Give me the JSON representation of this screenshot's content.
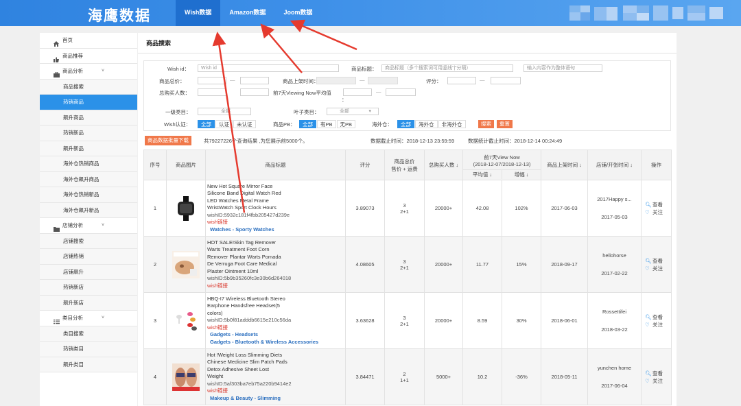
{
  "header": {
    "logo": "海鹰数据",
    "tabs": [
      {
        "label": "Wish数据",
        "active": true
      },
      {
        "label": "Amazon数据",
        "active": false
      },
      {
        "label": "Joom数据",
        "active": false
      }
    ]
  },
  "sidebar": {
    "items": [
      {
        "label": "首页",
        "level": "top",
        "icon": "home-icon"
      },
      {
        "label": "商品推荐",
        "level": "top",
        "icon": "thumbs-up-icon"
      },
      {
        "label": "商品分析",
        "level": "top",
        "icon": "briefcase-icon",
        "chevron": "˅"
      },
      {
        "label": "商品搜索",
        "level": "sub"
      },
      {
        "label": "热销商品",
        "level": "sub",
        "active": true
      },
      {
        "label": "飙升商品",
        "level": "sub"
      },
      {
        "label": "热销新品",
        "level": "sub"
      },
      {
        "label": "飙升新品",
        "level": "sub"
      },
      {
        "label": "海外仓热销商品",
        "level": "sub"
      },
      {
        "label": "海外仓飙升商品",
        "level": "sub"
      },
      {
        "label": "海外仓热销新品",
        "level": "sub"
      },
      {
        "label": "海外仓飙升新品",
        "level": "sub"
      },
      {
        "label": "店铺分析",
        "level": "top",
        "icon": "folder-icon",
        "chevron": "˅"
      },
      {
        "label": "店铺搜索",
        "level": "sub"
      },
      {
        "label": "店铺热销",
        "level": "sub"
      },
      {
        "label": "店铺飙升",
        "level": "sub"
      },
      {
        "label": "热销新店",
        "level": "sub"
      },
      {
        "label": "飙升新店",
        "level": "sub"
      },
      {
        "label": "类目分析",
        "level": "top",
        "icon": "list-icon",
        "chevron": "˅"
      },
      {
        "label": "类目搜索",
        "level": "sub"
      },
      {
        "label": "热销类目",
        "level": "sub"
      },
      {
        "label": "飙升类目",
        "level": "sub"
      }
    ]
  },
  "page": {
    "title": "商品搜索"
  },
  "filter": {
    "wish_id_label": "Wish id：",
    "wish_id_placeholder": "Wish id",
    "title_label": "商品标题：",
    "title_placeholder": "商品标题（多个搜索词可用竖线“|”分隔）",
    "exclude_placeholder": "输入内容作为整体语句",
    "total_price_label": "商品总价：",
    "listed_time_label": "商品上架时间：",
    "rating_label": "评分：",
    "buyers_label": "总购买人数：",
    "viewing_label": "前7天Viewing Now平均值",
    "viewing_colon": "：",
    "dash": "—",
    "cat1_label": "一级类目：",
    "cat1_value": "全部",
    "leaf_label": "叶子类目：",
    "leaf_value": "全部",
    "leaf_arrow": "▾",
    "wish_auth_label": "Wish认证：",
    "wish_auth_options": [
      "全部",
      "认证",
      "未认证"
    ],
    "pb_label": "商品PB：",
    "pb_options": [
      "全部",
      "有PB",
      "无PB"
    ],
    "overseas_label": "海外仓：",
    "overseas_options": [
      "全部",
      "海外仓",
      "非海外仓"
    ],
    "search_btn": "搜索",
    "reset_btn": "重置"
  },
  "results": {
    "export_btn": "商品数据批量下载",
    "count_text": "共79227226个查询结果 ,为您展示前5000个。",
    "data_cutoff": "数据截止时间：2018-12-13 23:59:59",
    "stats_cutoff": "数据统计截止时间：2018-12-14 00:24:49"
  },
  "table": {
    "headers": {
      "no": "序号",
      "image": "商品图片",
      "title": "商品标题",
      "rating": "评分",
      "price": "商品总价",
      "price2": "售价 + 运费",
      "buyers": "总购买人数 ↓",
      "viewing": "前7天View Now",
      "viewing_range": "(2018-12-07/2018-12-13)",
      "avg": "平均值 ↓",
      "growth": "增幅 ↓",
      "listed": "商品上架时间 ↓",
      "shop": "店铺/开张时间 ↓",
      "ops": "操作"
    },
    "rows": [
      {
        "no": "1",
        "lines": [
          "New Hot Square Mirror Face",
          "Silicone Band Digital Watch Red",
          "LED Watches Metal Frame",
          "WristWatch Sport Clock Hours"
        ],
        "wish_id": "wishID:5932c181f4fbb205427d239e",
        "wish_link": "wish链接",
        "cats": [
          "Watches - Sporty Watches"
        ],
        "rating": "3.89073",
        "price": "3",
        "price2": "2+1",
        "buyers": "20000+",
        "avg": "42.08",
        "growth": "102%",
        "listed": "2017-06-03",
        "shop": "2017Happy s...",
        "shop_date": "2017-05-03",
        "op_view": "查看",
        "op_follow": "关注",
        "thumb": "watch"
      },
      {
        "no": "2",
        "lines": [
          "HOT SALE!Skin Tag Remover",
          "Warts Treatment Foot Corn",
          "Remover Plantar Warts Pomada",
          "De Verruga Foot Care Medical",
          "Plaster Ointment 10ml"
        ],
        "wish_id": "wishID:5b9b35260fc3e30b6d264018",
        "wish_link": "wish链接",
        "cats": [],
        "rating": "4.08605",
        "price": "3",
        "price2": "2+1",
        "buyers": "20000+",
        "avg": "11.77",
        "growth": "15%",
        "listed": "2018-09-17",
        "shop": "hellohorse",
        "shop_date": "2017-02-22",
        "op_view": "查看",
        "op_follow": "关注",
        "thumb": "skin"
      },
      {
        "no": "3",
        "lines": [
          "HBQ-I7 Wireless Bluetooth Stereo",
          "Earphone Handsfree Headset(5",
          "colors)"
        ],
        "wish_id": "wishID:5b0f81adddb6615e210c56da",
        "wish_link": "wish链接",
        "cats": [
          "Gadgets - Headsets",
          "Gadgets - Bluetooth & Wireless Accessories"
        ],
        "rating": "3.63628",
        "price": "3",
        "price2": "2+1",
        "buyers": "20000+",
        "avg": "8.59",
        "growth": "30%",
        "listed": "2018-06-01",
        "shop": "Rossettifei",
        "shop_date": "2018-03-22",
        "op_view": "查看",
        "op_follow": "关注",
        "thumb": "earphone"
      },
      {
        "no": "4",
        "lines": [
          "Hot !Weight Loss Slimming Diets",
          "Chinese Medicine Slim Patch Pads",
          "Detox Adhesive Sheet Lost",
          "Weight"
        ],
        "wish_id": "wishID:5af303ba7eb75a220b9414e2",
        "wish_link": "wish链接",
        "cats": [
          "Makeup & Beauty - Slimming"
        ],
        "rating": "3.84471",
        "price": "2",
        "price2": "1+1",
        "buyers": "5000+",
        "avg": "10.2",
        "growth": "-36%",
        "listed": "2018-05-11",
        "shop": "yunchen home",
        "shop_date": "2017-06-04",
        "op_view": "查看",
        "op_follow": "关注",
        "thumb": "slim"
      }
    ]
  }
}
